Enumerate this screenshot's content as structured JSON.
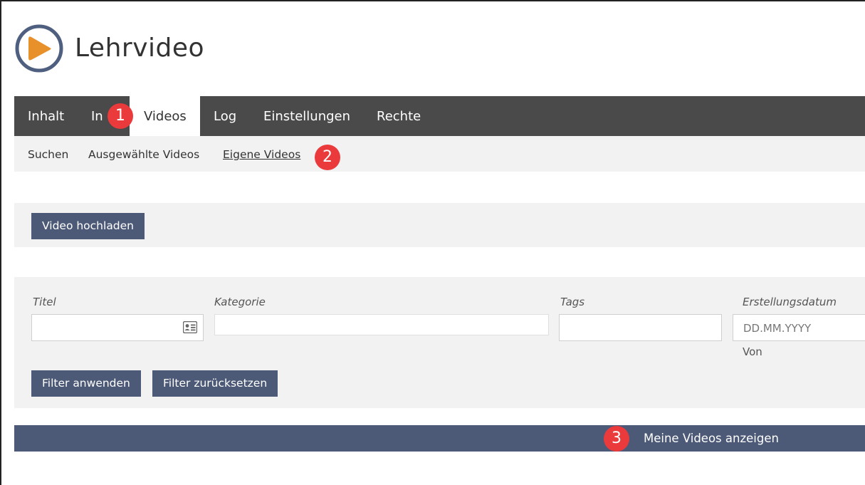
{
  "app": {
    "title": "Lehrvideo",
    "logo_icon": "play-icon",
    "accent_color": "#e8902a",
    "ring_color": "#4f5f80"
  },
  "tabs": [
    {
      "label": "Inhalt"
    },
    {
      "label": "In"
    },
    {
      "label": "Videos",
      "active": true
    },
    {
      "label": "Log"
    },
    {
      "label": "Einstellungen"
    },
    {
      "label": "Rechte"
    }
  ],
  "subtabs": [
    {
      "label": "Suchen"
    },
    {
      "label": "Ausgewählte Videos"
    },
    {
      "label": "Eigene Videos",
      "active": true
    }
  ],
  "toolbar": {
    "upload_label": "Video hochladen"
  },
  "filters": {
    "titel": {
      "label": "Titel",
      "value": ""
    },
    "kategorie": {
      "label": "Kategorie",
      "value": ""
    },
    "tags": {
      "label": "Tags",
      "value": ""
    },
    "datum": {
      "label": "Erstellungsdatum",
      "placeholder": "DD.MM.YYYY",
      "sub_label": "Von"
    },
    "apply_label": "Filter anwenden",
    "reset_label": "Filter zurücksetzen"
  },
  "results_bar": {
    "label": "Meine Videos anzeigen"
  },
  "markers": [
    "1",
    "2",
    "3"
  ],
  "colors": {
    "tabbar": "#4a4a4a",
    "button": "#4c5a78",
    "marker": "#ea3a3c",
    "panel": "#f2f2f2"
  }
}
